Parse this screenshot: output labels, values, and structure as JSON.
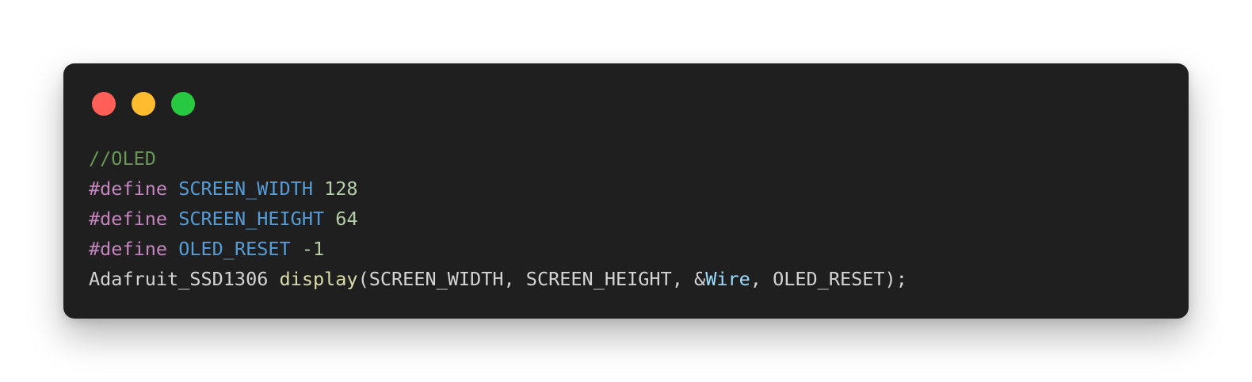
{
  "window_controls": {
    "close": "#ff5f57",
    "minimize": "#febc2e",
    "maximize": "#28c840"
  },
  "code": {
    "colors": {
      "comment": "#6a9955",
      "keyword": "#c586c0",
      "macro": "#569cd6",
      "number": "#b5cea8",
      "plain": "#d4d4d4",
      "function": "#dcdcaa",
      "variable": "#9cdcfe"
    },
    "lines": [
      [
        {
          "t": "//OLED",
          "c": "comment"
        }
      ],
      [
        {
          "t": "#define",
          "c": "keyword"
        },
        {
          "t": " ",
          "c": "plain"
        },
        {
          "t": "SCREEN_WIDTH",
          "c": "macro"
        },
        {
          "t": " ",
          "c": "plain"
        },
        {
          "t": "128",
          "c": "number"
        }
      ],
      [
        {
          "t": "#define",
          "c": "keyword"
        },
        {
          "t": " ",
          "c": "plain"
        },
        {
          "t": "SCREEN_HEIGHT",
          "c": "macro"
        },
        {
          "t": " ",
          "c": "plain"
        },
        {
          "t": "64",
          "c": "number"
        }
      ],
      [
        {
          "t": "#define",
          "c": "keyword"
        },
        {
          "t": " ",
          "c": "plain"
        },
        {
          "t": "OLED_RESET",
          "c": "macro"
        },
        {
          "t": " ",
          "c": "plain"
        },
        {
          "t": "-1",
          "c": "number"
        }
      ],
      [
        {
          "t": "Adafruit_SSD1306",
          "c": "plain"
        },
        {
          "t": " ",
          "c": "plain"
        },
        {
          "t": "display",
          "c": "function"
        },
        {
          "t": "(SCREEN_WIDTH, SCREEN_HEIGHT, &",
          "c": "plain"
        },
        {
          "t": "Wire",
          "c": "variable"
        },
        {
          "t": ", OLED_RESET);",
          "c": "plain"
        }
      ]
    ]
  }
}
